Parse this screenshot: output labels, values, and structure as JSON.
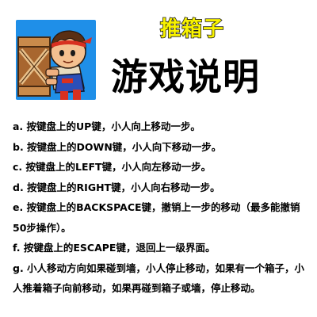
{
  "logo": {
    "icon": "sokoban-boy-pushing-crate-icon",
    "background": "#1f8fe8"
  },
  "subtitle": "推箱子",
  "title": "游戏说明",
  "colors": {
    "subtitle_fill": "#f8f200",
    "subtitle_outline": "#1a1a1a",
    "text": "#000000"
  },
  "rules": [
    "a. 按键盘上的UP键，小人向上移动一步。",
    "b. 按键盘上的DOWN键，小人向下移动一步。",
    "c. 按键盘上的LEFT键，小人向左移动一步。",
    "d. 按键盘上的RIGHT键，小人向右移动一步。",
    "e. 按键盘上的BACKSPACE键，撤销上一步的移动（最多能撤销50步操作）。",
    "f. 按键盘上的ESCAPE键，退回上一级界面。",
    "g. 小人移动方向如果碰到墙，小人停止移动，如果有一个箱子，小人推着箱子向前移动，如果再碰到箱子或墙，停止移动。"
  ]
}
